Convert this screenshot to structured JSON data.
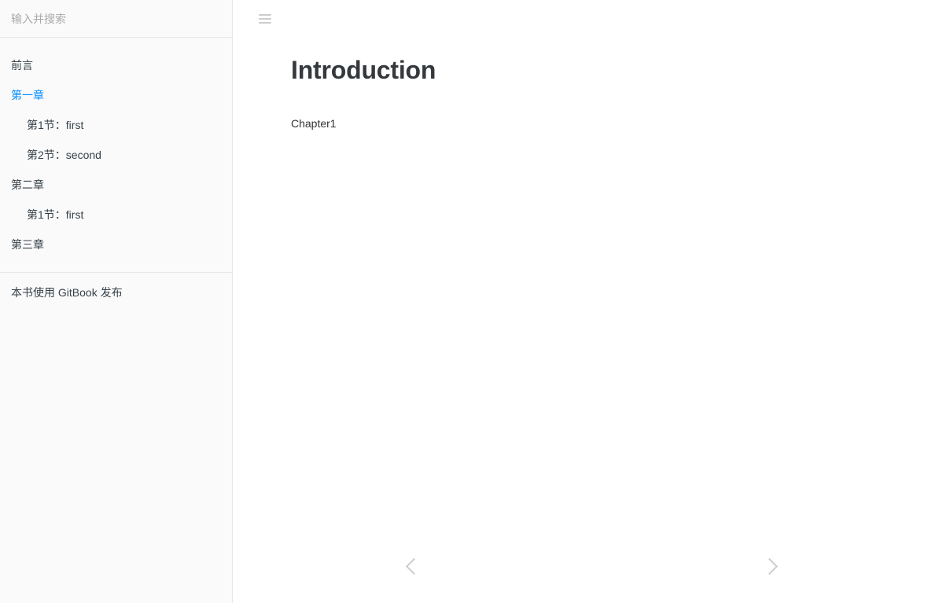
{
  "search": {
    "placeholder": "输入并搜索",
    "value": ""
  },
  "sidebar": {
    "items": [
      {
        "label": "前言",
        "level": 1,
        "active": false
      },
      {
        "label": "第一章",
        "level": 1,
        "active": true
      },
      {
        "label": "第1节：first",
        "level": 2,
        "active": false
      },
      {
        "label": "第2节：second",
        "level": 2,
        "active": false
      },
      {
        "label": "第二章",
        "level": 1,
        "active": false
      },
      {
        "label": "第1节：first",
        "level": 2,
        "active": false
      },
      {
        "label": "第三章",
        "level": 1,
        "active": false
      }
    ],
    "footer_text": "本书使用 GitBook 发布"
  },
  "header": {
    "toggle_icon": "hamburger-icon"
  },
  "main": {
    "title": "Introduction",
    "paragraph": "Chapter1"
  },
  "navigation": {
    "prev_icon": "chevron-left-icon",
    "next_icon": "chevron-right-icon"
  },
  "colors": {
    "accent": "#008cff",
    "sidebar_bg": "#fafafa",
    "border": "#e7e7e7",
    "text": "#364149",
    "title": "#34393d",
    "muted": "#cccccc",
    "placeholder": "#aaaaaa"
  }
}
